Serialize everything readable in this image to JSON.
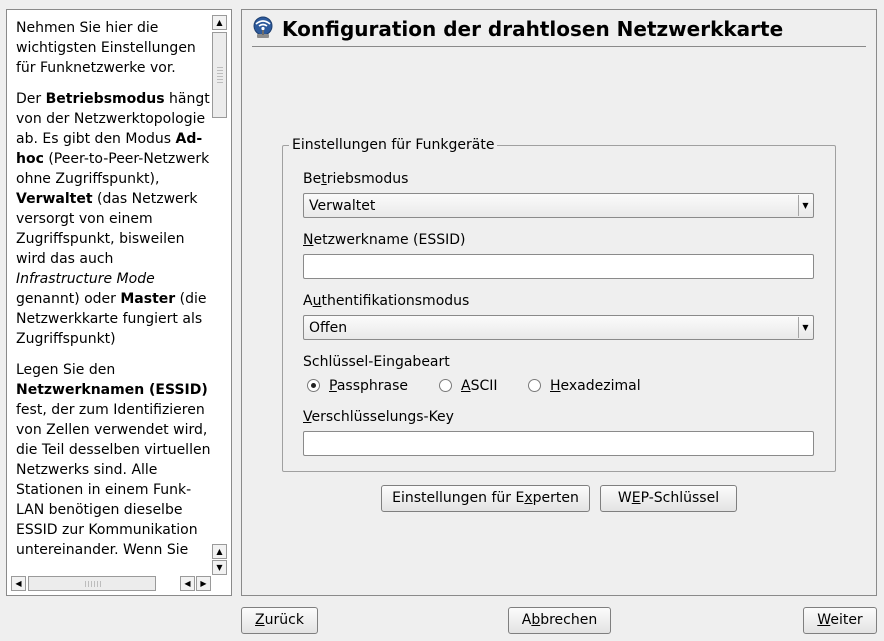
{
  "help": {
    "p1": "Nehmen Sie hier die wichtigsten Einstellungen für Funknetzwerke vor.",
    "p2_a": "Der ",
    "p2_b": "Betriebsmodus",
    "p2_c": " hängt von der Netzwerktopologie ab. Es gibt den Modus ",
    "p2_d": "Ad-hoc",
    "p2_e": " (Peer-to-Peer-Netzwerk ohne Zugriffspunkt), ",
    "p2_f": "Verwaltet",
    "p2_g": " (das Netzwerk versorgt von einem Zugriffspunkt, bisweilen wird das auch ",
    "p2_h": "Infrastructure Mode",
    "p2_i": " genannt) oder ",
    "p2_j": "Master",
    "p2_k": " (die Netzwerkkarte fungiert als Zugriffspunkt)",
    "p3_a": "Legen Sie den ",
    "p3_b": "Netzwerknamen (ESSID)",
    "p3_c": " fest, der zum Identifizieren von Zellen verwendet wird, die Teil desselben virtuellen Netzwerks sind. Alle Stationen in einem Funk-LAN benötigen dieselbe ESSID zur Kommunikation untereinander. Wenn Sie"
  },
  "page": {
    "title": "Konfiguration der drahtlosen Netzwerkkarte"
  },
  "group": {
    "legend": "Einstellungen für Funkgeräte",
    "mode": {
      "label_pre": "Be",
      "label_key": "t",
      "label_post": "riebsmodus",
      "value": "Verwaltet"
    },
    "essid": {
      "label_pre": "",
      "label_key": "N",
      "label_post": "etzwerkname (ESSID)",
      "value": ""
    },
    "auth": {
      "label_pre": "A",
      "label_key": "u",
      "label_post": "thentifikationsmodus",
      "value": "Offen"
    },
    "keytype": {
      "label": "Schlüssel-Eingabeart",
      "options": [
        {
          "pre": "",
          "key": "P",
          "post": "assphrase",
          "selected": true
        },
        {
          "pre": "",
          "key": "A",
          "post": "SCII",
          "selected": false
        },
        {
          "pre": "",
          "key": "H",
          "post": "exadezimal",
          "selected": false
        }
      ]
    },
    "key": {
      "label_pre": "",
      "label_key": "V",
      "label_post": "erschlüsselungs-Key",
      "value": ""
    }
  },
  "actions": {
    "experts": {
      "pre": "Einstellungen für E",
      "key": "x",
      "post": "perten"
    },
    "wep": {
      "pre": "W",
      "key": "E",
      "post": "P-Schlüssel"
    }
  },
  "footer": {
    "back": {
      "pre": "",
      "key": "Z",
      "post": "urück"
    },
    "abort": {
      "pre": "A",
      "key": "b",
      "post": "brechen"
    },
    "next": {
      "pre": "",
      "key": "W",
      "post": "eiter"
    }
  },
  "icons": {
    "wlan": "wireless-network-icon",
    "arrow_up": "▲",
    "arrow_down": "▼",
    "arrow_left": "◀",
    "arrow_right": "▶"
  }
}
